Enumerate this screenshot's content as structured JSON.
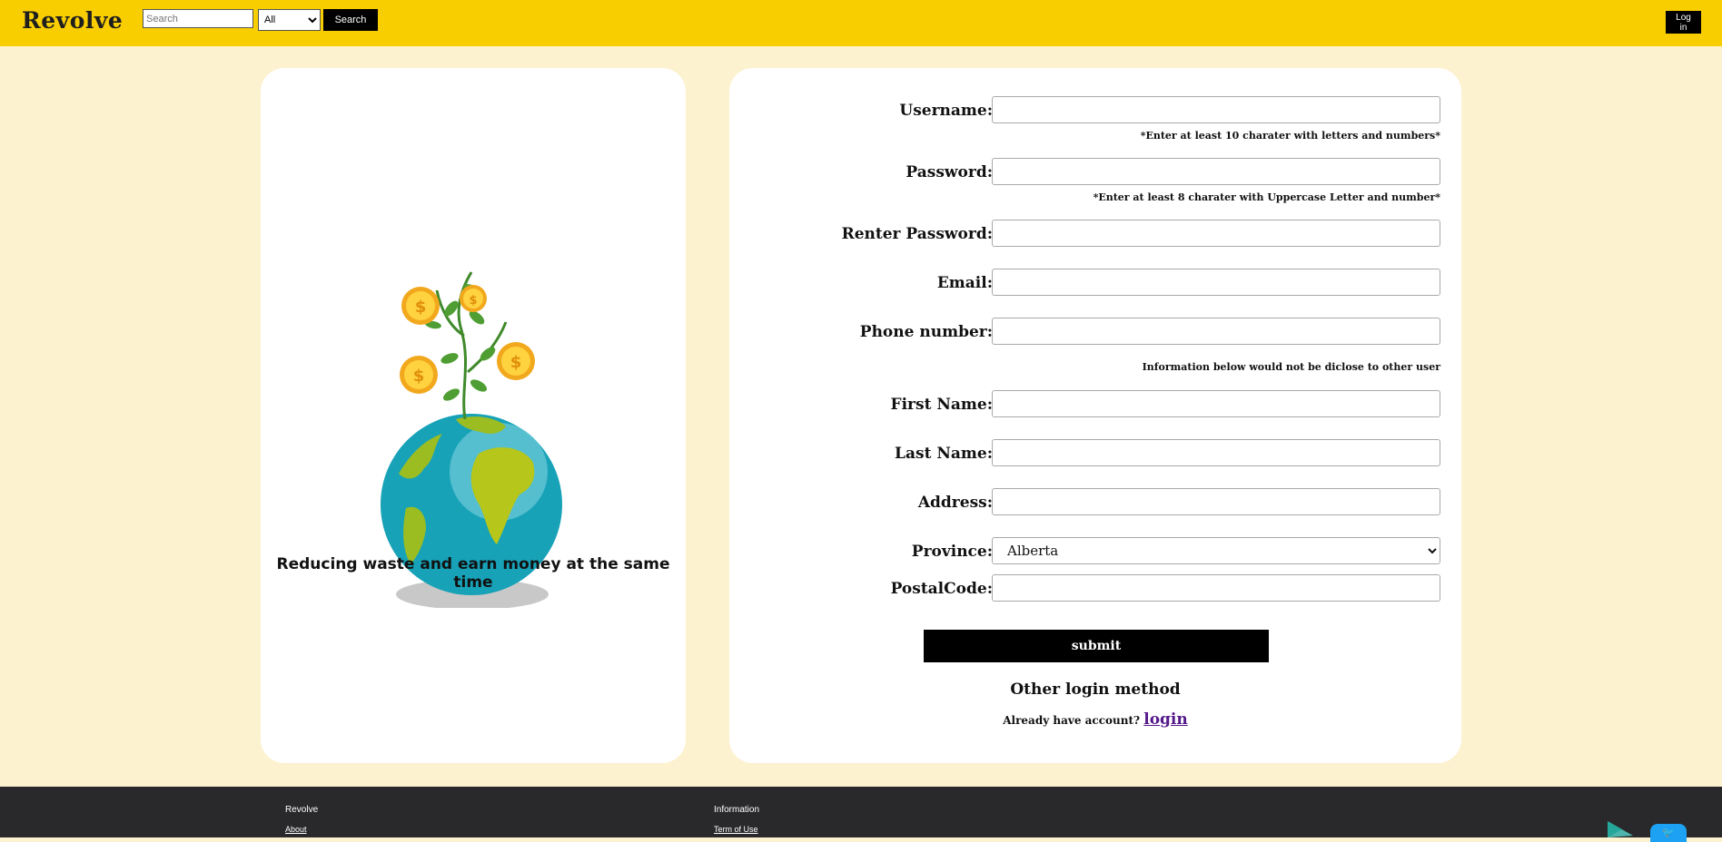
{
  "header": {
    "logo": "Revolve",
    "search_placeholder": "Search",
    "category_selected": "All",
    "search_button": "Search",
    "login_button": "Log in"
  },
  "left": {
    "tagline": "Reducing waste and earn money at the same time"
  },
  "form": {
    "username_label": "Username:",
    "username_hint": "*Enter at least 10 charater with letters and numbers*",
    "password_label": "Password:",
    "password_hint": "*Enter at least 8 charater with Uppercase Letter and number*",
    "repassword_label": "Renter Password:",
    "email_label": "Email:",
    "phone_label": "Phone number:",
    "privacy_note": "Information below would not be diclose to other user",
    "firstname_label": "First Name:",
    "lastname_label": "Last Name:",
    "address_label": "Address:",
    "province_label": "Province:",
    "province_selected": "Alberta",
    "postal_label": "PostalCode:",
    "submit_label": "submit",
    "other_login": "Other login method",
    "have_account": "Already have account?",
    "login_link": "login"
  },
  "footer": {
    "col1_title": "Revolve",
    "col1_link": "About",
    "col2_title": "Information",
    "col2_link": "Term of Use"
  },
  "colors": {
    "header_bg": "#f9ce00",
    "page_bg": "#fdf2d0",
    "footer_bg": "#29292b",
    "link": "#551a8b"
  }
}
